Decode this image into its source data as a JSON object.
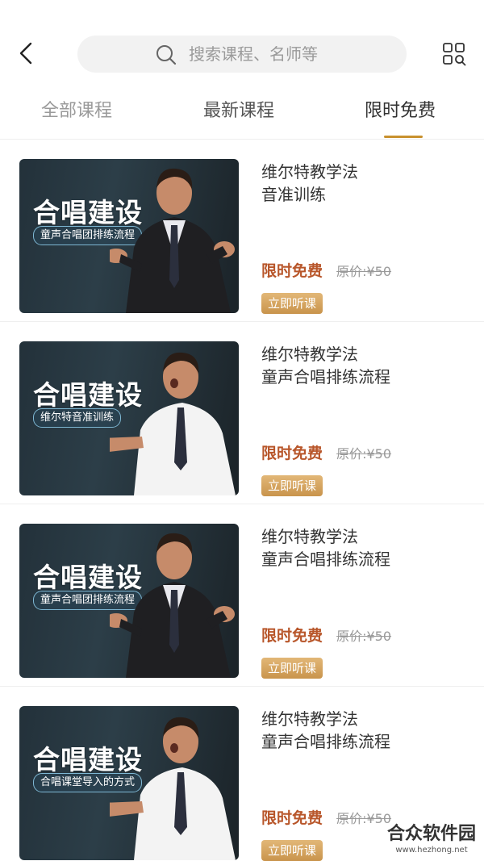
{
  "header": {
    "search_placeholder": "搜索课程、名师等"
  },
  "tabs": [
    {
      "label": "全部课程",
      "active": false
    },
    {
      "label": "最新课程",
      "active": false
    },
    {
      "label": "限时免费",
      "active": true
    }
  ],
  "accent_color": "#c8912e",
  "price_color": "#b8562a",
  "courses": [
    {
      "thumb_title": "合唱建设",
      "thumb_subtitle": "童声合唱团排练流程",
      "title_line1": "维尔特教学法",
      "title_line2": "音准训练",
      "price_label": "限时免费",
      "original_price": "原价:¥50",
      "button_label": "立即听课"
    },
    {
      "thumb_title": "合唱建设",
      "thumb_subtitle": "维尔特音准训练",
      "title_line1": "维尔特教学法",
      "title_line2": "童声合唱排练流程",
      "price_label": "限时免费",
      "original_price": "原价:¥50",
      "button_label": "立即听课"
    },
    {
      "thumb_title": "合唱建设",
      "thumb_subtitle": "童声合唱团排练流程",
      "title_line1": "维尔特教学法",
      "title_line2": "童声合唱排练流程",
      "price_label": "限时免费",
      "original_price": "原价:¥50",
      "button_label": "立即听课"
    },
    {
      "thumb_title": "合唱建设",
      "thumb_subtitle": "合唱课堂导入的方式",
      "title_line1": "维尔特教学法",
      "title_line2": "童声合唱排练流程",
      "price_label": "限时免费",
      "original_price": "原价:¥50",
      "button_label": "立即听课"
    }
  ],
  "watermark": {
    "main": "合众软件园",
    "sub": "www.hezhong.net"
  }
}
